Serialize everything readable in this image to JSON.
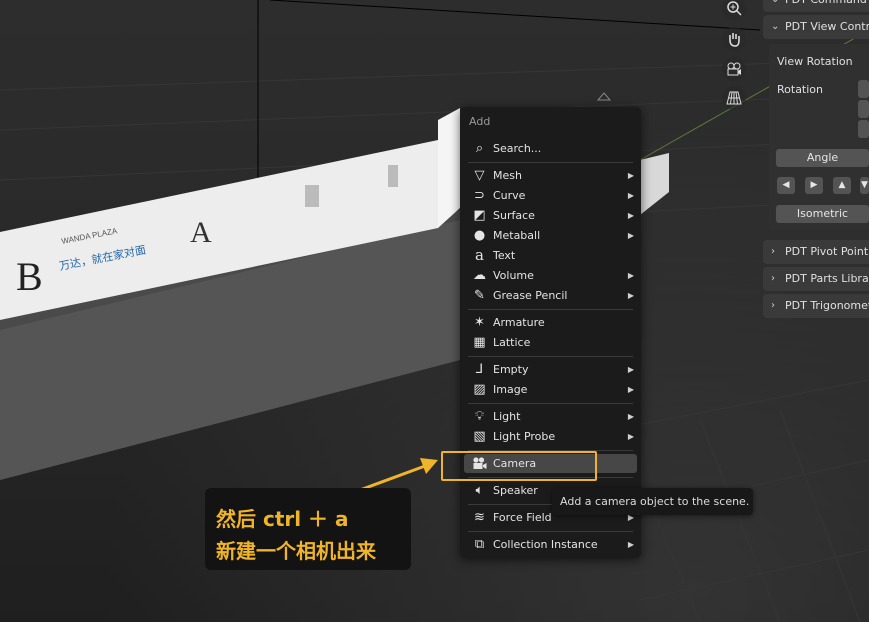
{
  "colors": {
    "accent": "#f0b429",
    "menu_bg": "#1b1b1b",
    "highlight_row": "#474747",
    "panel_header": "#3a3a3a"
  },
  "viewport_tools": [
    {
      "icon": "zoom-icon"
    },
    {
      "icon": "hand-pan-icon"
    },
    {
      "icon": "camera-view-icon"
    },
    {
      "icon": "grid-perspective-icon"
    }
  ],
  "panel": {
    "headers": [
      {
        "label": "PDT Command",
        "expanded": true
      },
      {
        "label": "PDT View Contr",
        "expanded": true
      },
      {
        "label": "PDT Pivot Point",
        "expanded": false
      },
      {
        "label": "PDT Parts Librar",
        "expanded": false
      },
      {
        "label": "PDT Trigonomet",
        "expanded": false
      }
    ],
    "view_rotation_label": "View Rotation",
    "rotation_label": "Rotation",
    "angle_button": "Angle",
    "isometric_button": "Isometric",
    "step_buttons": [
      "◀",
      "▶",
      "▲",
      "▼"
    ]
  },
  "menu": {
    "title": "Add",
    "items": [
      {
        "label": "Search...",
        "icon": "search-icon",
        "submenu": false
      },
      {
        "label": "Mesh",
        "icon": "mesh-icon",
        "submenu": true
      },
      {
        "label": "Curve",
        "icon": "curve-icon",
        "submenu": true
      },
      {
        "label": "Surface",
        "icon": "surface-icon",
        "submenu": true
      },
      {
        "label": "Metaball",
        "icon": "metaball-icon",
        "submenu": true
      },
      {
        "label": "Text",
        "icon": "text-icon",
        "submenu": false
      },
      {
        "label": "Volume",
        "icon": "volume-icon",
        "submenu": true
      },
      {
        "label": "Grease Pencil",
        "icon": "grease-pencil-icon",
        "submenu": true
      },
      {
        "label": "Armature",
        "icon": "armature-icon",
        "submenu": false
      },
      {
        "label": "Lattice",
        "icon": "lattice-icon",
        "submenu": false
      },
      {
        "label": "Empty",
        "icon": "empty-icon",
        "submenu": true
      },
      {
        "label": "Image",
        "icon": "image-icon",
        "submenu": true
      },
      {
        "label": "Light",
        "icon": "light-icon",
        "submenu": true
      },
      {
        "label": "Light Probe",
        "icon": "light-probe-icon",
        "submenu": true
      },
      {
        "label": "Camera",
        "icon": "camera-icon",
        "submenu": false,
        "highlighted": true
      },
      {
        "label": "Speaker",
        "icon": "speaker-icon",
        "submenu": false
      },
      {
        "label": "Force Field",
        "icon": "force-field-icon",
        "submenu": true
      },
      {
        "label": "Collection Instance",
        "icon": "collection-icon",
        "submenu": true
      }
    ]
  },
  "tooltip": "Add a camera object to the scene.",
  "annotation": {
    "line1": "然后 ctrl ＋ a",
    "line2": "新建一个相机出来"
  },
  "signs": {
    "brand_small": "WANDA PLAZA",
    "brand_cn": "万达，就在家对面",
    "letter_b": "B",
    "letter_a": "A"
  }
}
